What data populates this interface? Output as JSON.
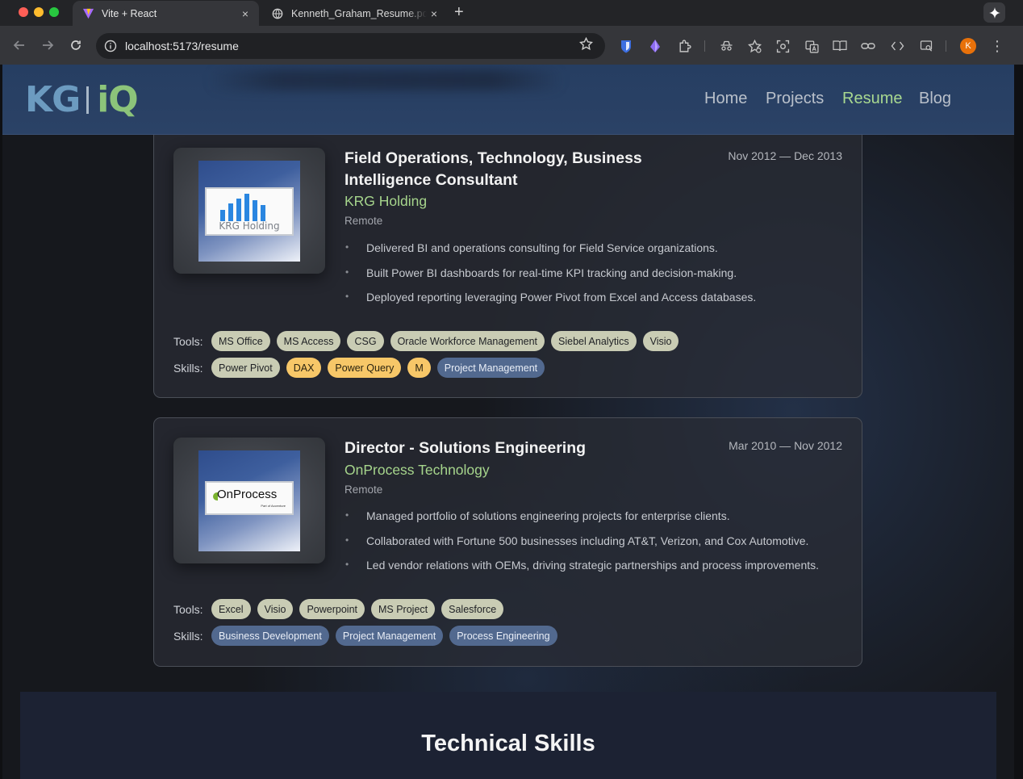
{
  "browser": {
    "tabs": [
      {
        "title": "Vite + React",
        "active": true,
        "favicon": "vite-favicon"
      },
      {
        "title": "Kenneth_Graham_Resume.pdf",
        "active": false,
        "favicon": "globe-icon"
      }
    ],
    "close_glyph": "×",
    "new_tab_glyph": "+",
    "url": "localhost:5173/resume",
    "profile_initial": "K"
  },
  "site": {
    "logo_left": "KG",
    "logo_right": "iQ",
    "nav": [
      {
        "label": "Home",
        "active": false
      },
      {
        "label": "Projects",
        "active": false
      },
      {
        "label": "Resume",
        "active": true
      },
      {
        "label": "Blog",
        "active": false
      }
    ]
  },
  "jobs": [
    {
      "title": "Field Operations, Technology, Business Intelligence Consultant",
      "company": "KRG Holding",
      "location": "Remote",
      "dates": "Nov 2012 — Dec 2013",
      "logo_text": "KRG Holding",
      "bullets": [
        "Delivered BI and operations consulting for Field Service organizations.",
        "Built Power BI dashboards for real-time KPI tracking and decision-making.",
        "Deployed reporting leveraging Power Pivot from Excel and Access databases."
      ],
      "tools_label": "Tools:",
      "tools": [
        "MS Office",
        "MS Access",
        "CSG",
        "Oracle Workforce Management",
        "Siebel Analytics",
        "Visio"
      ],
      "skills_label": "Skills:",
      "skills": [
        {
          "label": "Power Pivot",
          "style": "neutral"
        },
        {
          "label": "DAX",
          "style": "gold"
        },
        {
          "label": "Power Query",
          "style": "gold"
        },
        {
          "label": "M",
          "style": "gold"
        },
        {
          "label": "Project Management",
          "style": "blue"
        }
      ]
    },
    {
      "title": "Director - Solutions Engineering",
      "company": "OnProcess Technology",
      "location": "Remote",
      "dates": "Mar 2010 — Nov 2012",
      "logo_text": "OnProcess",
      "logo_subtext": "Part of Accenture",
      "bullets": [
        "Managed portfolio of solutions engineering projects for enterprise clients.",
        "Collaborated with Fortune 500 businesses including AT&T, Verizon, and Cox Automotive.",
        "Led vendor relations with OEMs, driving strategic partnerships and process improvements."
      ],
      "tools_label": "Tools:",
      "tools": [
        "Excel",
        "Visio",
        "Powerpoint",
        "MS Project",
        "Salesforce"
      ],
      "skills_label": "Skills:",
      "skills": [
        {
          "label": "Business Development",
          "style": "blue"
        },
        {
          "label": "Project Management",
          "style": "blue"
        },
        {
          "label": "Process Engineering",
          "style": "blue"
        }
      ]
    }
  ],
  "technical_skills": {
    "heading": "Technical Skills"
  },
  "colors": {
    "nav_active": "#a8d890",
    "company": "#a6d58c",
    "tag_tool": "#c9ccb4",
    "tag_gold": "#f7c768",
    "tag_blue": "#52698f",
    "header_bg": "#263e62"
  }
}
